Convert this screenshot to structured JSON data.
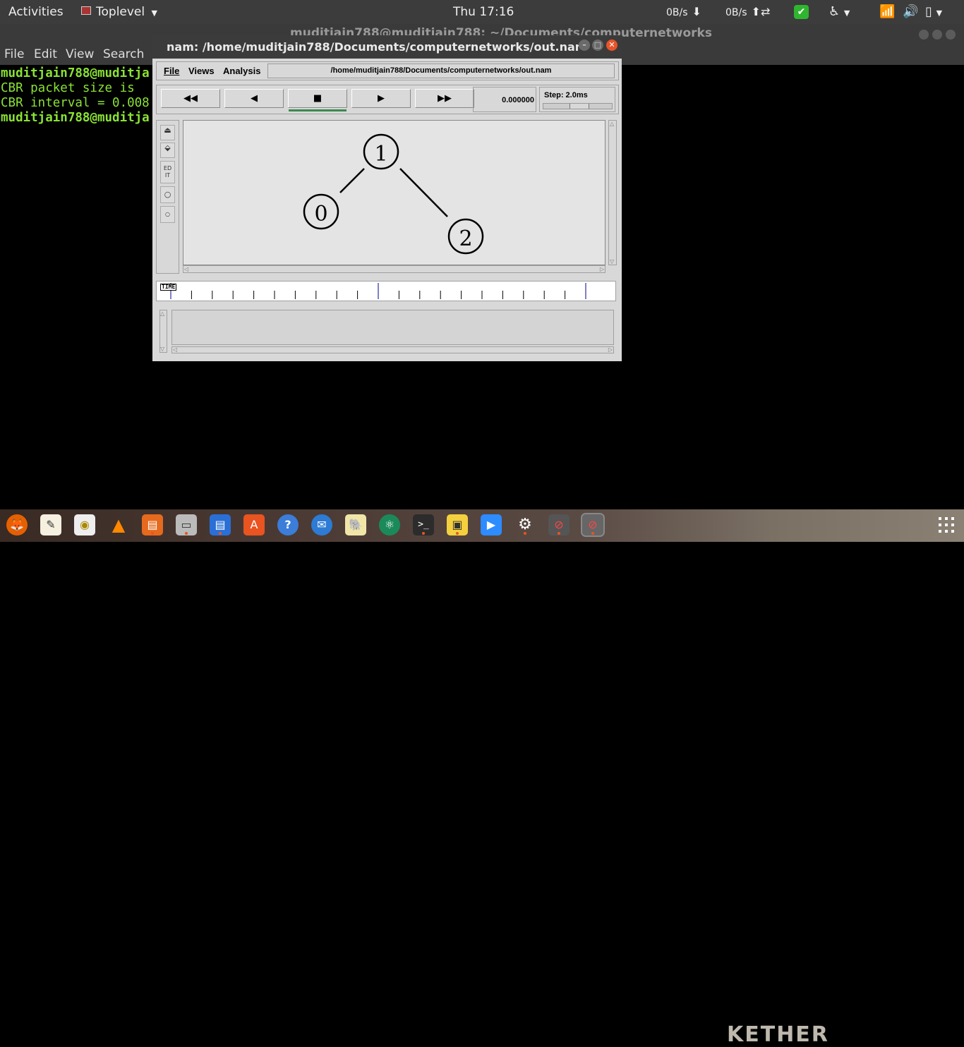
{
  "topbar": {
    "activities": "Activities",
    "app_menu": "Toplevel",
    "clock": "Thu 17:16",
    "net_down": "0B/s",
    "net_up": "0B/s"
  },
  "terminal": {
    "title": "muditjain788@muditjain788: ~/Documents/computernetworks",
    "menu": [
      "File",
      "Edit",
      "View",
      "Search"
    ],
    "lines": [
      "muditjain788@muditja",
      "CBR packet size is",
      "CBR interval = 0.008",
      "muditjain788@muditja"
    ]
  },
  "nam": {
    "title": "nam: /home/muditjain788/Documents/computernetworks/out.nam",
    "menu": {
      "file": "File",
      "views": "Views",
      "analysis": "Analysis"
    },
    "file_path": "/home/muditjain788/Documents/computernetworks/out.nam",
    "time_value": "0.000000",
    "step_label": "Step: 2.0ms",
    "timeline_label": "TIME",
    "tool_edit": "ED\nIT",
    "nodes": [
      {
        "id": "1"
      },
      {
        "id": "0"
      },
      {
        "id": "2"
      }
    ],
    "links": [
      [
        "1",
        "0"
      ],
      [
        "1",
        "2"
      ]
    ]
  },
  "dock": {
    "apps": [
      "firefox",
      "text-editor",
      "rhythmbox",
      "vlc",
      "presentation",
      "files",
      "writer",
      "software-center",
      "help",
      "thunderbird",
      "terminal-emulator",
      "atom",
      "terminal",
      "image-viewer",
      "zoom",
      "settings",
      "nam-window-1",
      "nam-window-2"
    ],
    "brand_text": "KETHER"
  }
}
